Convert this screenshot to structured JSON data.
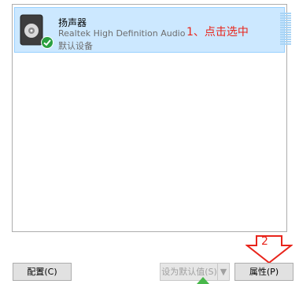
{
  "device": {
    "name": "扬声器",
    "driver": "Realtek High Definition Audio",
    "status": "默认设备"
  },
  "annotations": {
    "step1": "1、点击选中",
    "step2": "2"
  },
  "buttons": {
    "configure": "配置(C)",
    "set_default": "设为默认值(S)",
    "set_default_arrow": "▼",
    "properties": "属性(P)"
  },
  "colors": {
    "selection_bg": "#cce8ff",
    "annotation": "#e8241b"
  }
}
